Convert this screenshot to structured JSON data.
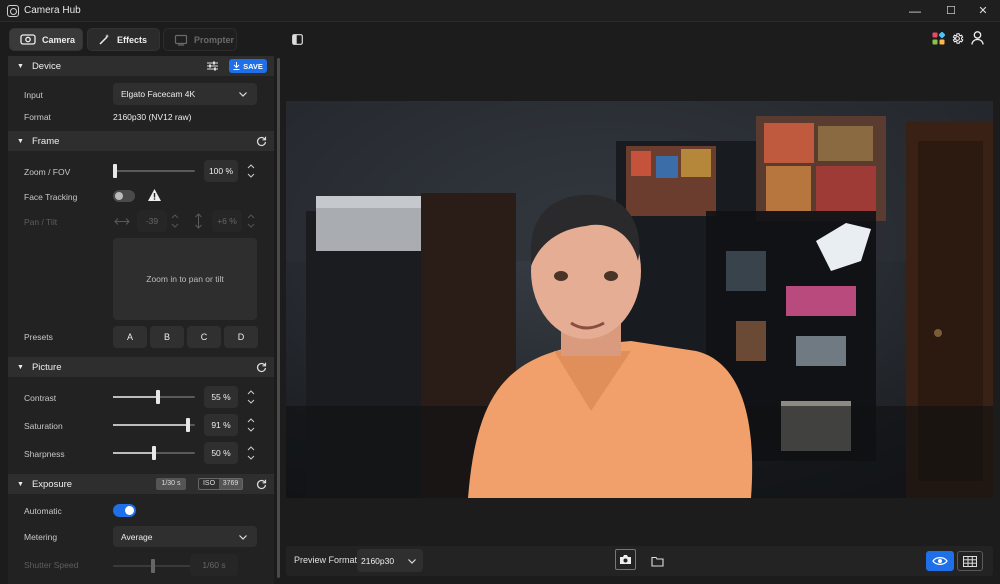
{
  "window": {
    "title": "Camera Hub",
    "minimize": "—",
    "maximize": "☐",
    "close": "✕"
  },
  "tabs": [
    {
      "label": "Camera",
      "icon": "webcam-icon",
      "active": true
    },
    {
      "label": "Effects",
      "icon": "magic-wand-icon",
      "active": false
    },
    {
      "label": "Prompter",
      "icon": "teleprompter-icon",
      "active": false,
      "disabled": true
    }
  ],
  "toolbar_icons": [
    "collapse-panel-icon",
    "color-apps-icon",
    "gear-icon",
    "user-icon"
  ],
  "device": {
    "header": "Device",
    "save_label": "SAVE",
    "input_label": "Input",
    "input_value": "Elgato Facecam 4K",
    "format_label": "Format",
    "format_value": "2160p30 (NV12 raw)"
  },
  "frame": {
    "header": "Frame",
    "zoom_label": "Zoom / FOV",
    "zoom_value": "100 %",
    "zoom_level": 0,
    "face_tracking_label": "Face Tracking",
    "face_tracking_on": false,
    "pan_tilt_label": "Pan / Tilt",
    "pan_value": "-39",
    "tilt_value": "+6 %",
    "pan_hint": "Zoom in to pan or tilt",
    "presets_label": "Presets",
    "presets": [
      "A",
      "B",
      "C",
      "D"
    ]
  },
  "picture": {
    "header": "Picture",
    "contrast_label": "Contrast",
    "contrast_value": "55 %",
    "contrast_level": 0.55,
    "saturation_label": "Saturation",
    "saturation_value": "91 %",
    "saturation_level": 0.91,
    "sharpness_label": "Sharpness",
    "sharpness_value": "50 %",
    "sharpness_level": 0.5
  },
  "exposure": {
    "header": "Exposure",
    "shutter_badge": "1/30 s",
    "iso_badge_label": "ISO",
    "iso_badge_value": "3769",
    "automatic_label": "Automatic",
    "automatic_on": true,
    "metering_label": "Metering",
    "metering_value": "Average",
    "shutter_label": "Shutter Speed",
    "shutter_value": "1/60 s"
  },
  "bottom": {
    "preview_format_label": "Preview Format",
    "preview_format_value": "2160p30"
  },
  "colors": {
    "accent": "#1e6fe8",
    "panel": "#222222",
    "section_header": "#2e2e2e",
    "shirt": "#f2a06b"
  }
}
